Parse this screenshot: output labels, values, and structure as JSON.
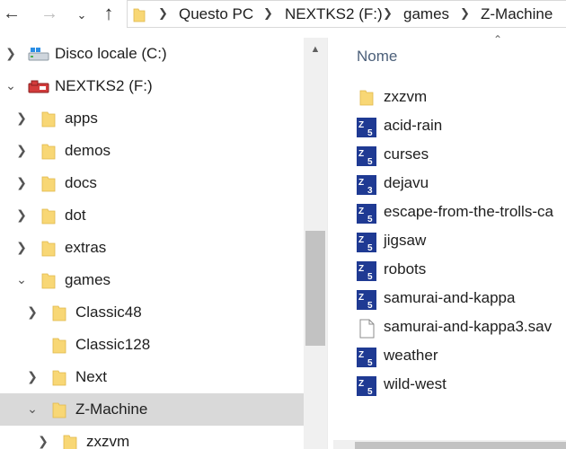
{
  "breadcrumb": [
    "Questo PC",
    "NEXTKS2 (F:)",
    "games",
    "Z-Machine"
  ],
  "nav_tree": [
    {
      "label": "Disco locale (C:)",
      "icon": "local-disk-icon",
      "expander": "collapsed"
    },
    {
      "label": "NEXTKS2 (F:)",
      "icon": "usb-drive-icon",
      "expander": "expanded"
    },
    {
      "label": "apps",
      "icon": "folder-icon",
      "expander": "collapsed"
    },
    {
      "label": "demos",
      "icon": "folder-icon",
      "expander": "collapsed"
    },
    {
      "label": "docs",
      "icon": "folder-icon",
      "expander": "collapsed"
    },
    {
      "label": "dot",
      "icon": "folder-icon",
      "expander": "collapsed"
    },
    {
      "label": "extras",
      "icon": "folder-icon",
      "expander": "collapsed"
    },
    {
      "label": "games",
      "icon": "folder-icon",
      "expander": "expanded"
    },
    {
      "label": "Classic48",
      "icon": "folder-icon",
      "expander": "collapsed"
    },
    {
      "label": "Classic128",
      "icon": "folder-icon",
      "expander": "none"
    },
    {
      "label": "Next",
      "icon": "folder-icon",
      "expander": "collapsed"
    },
    {
      "label": "Z-Machine",
      "icon": "folder-icon",
      "expander": "expanded",
      "selected": true
    },
    {
      "label": "zxzvm",
      "icon": "folder-icon",
      "expander": "collapsed"
    }
  ],
  "list_header": {
    "name": "Nome"
  },
  "files": [
    {
      "name": "zxzvm",
      "type": "folder",
      "icon": "folder-icon"
    },
    {
      "name": "acid-rain",
      "type": "zcode",
      "version": "5",
      "icon": "z-machine-story-icon"
    },
    {
      "name": "curses",
      "type": "zcode",
      "version": "5",
      "icon": "z-machine-story-icon"
    },
    {
      "name": "dejavu",
      "type": "zcode",
      "version": "3",
      "icon": "z-machine-story-icon"
    },
    {
      "name": "escape-from-the-trolls-ca",
      "type": "zcode",
      "version": "5",
      "icon": "z-machine-story-icon"
    },
    {
      "name": "jigsaw",
      "type": "zcode",
      "version": "5",
      "icon": "z-machine-story-icon"
    },
    {
      "name": "robots",
      "type": "zcode",
      "version": "5",
      "icon": "z-machine-story-icon"
    },
    {
      "name": "samurai-and-kappa",
      "type": "zcode",
      "version": "5",
      "icon": "z-machine-story-icon"
    },
    {
      "name": "samurai-and-kappa3.sav",
      "type": "file",
      "icon": "blank-document-icon"
    },
    {
      "name": "weather",
      "type": "zcode",
      "version": "5",
      "icon": "z-machine-story-icon"
    },
    {
      "name": "wild-west",
      "type": "zcode",
      "version": "5",
      "icon": "z-machine-story-icon"
    }
  ],
  "colors": {
    "selection": "#d9d9d9",
    "folder": "#f8d775",
    "zcode_icon": "#1f3a93",
    "header_text": "#4c607a"
  }
}
